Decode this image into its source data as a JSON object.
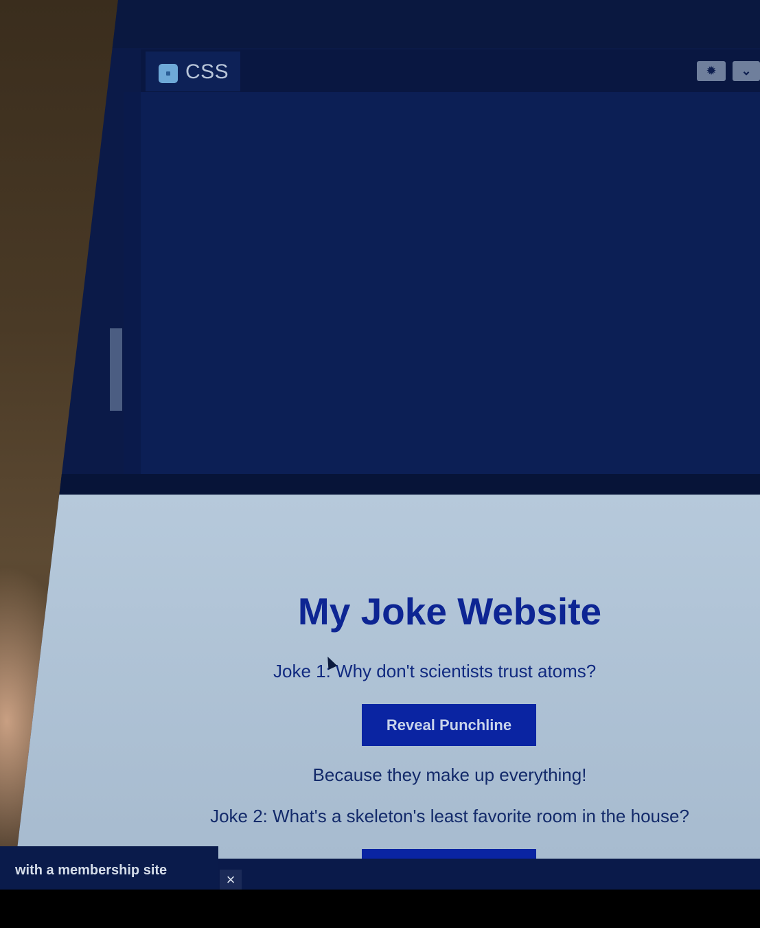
{
  "editor": {
    "tab_label": "CSS",
    "tab_icon": "css-file-icon",
    "settings_icon": "gear-icon",
    "expand_icon": "chevron-down-icon"
  },
  "preview": {
    "title": "My Joke Website",
    "joke1": "Joke 1: Why don't scientists trust atoms?",
    "reveal_label": "Reveal Punchline",
    "punchline1": "Because they make up everything!",
    "joke2": "Joke 2: What's a skeleton's least favorite room in the house?"
  },
  "overlay": {
    "membership_text": "with a membership site",
    "close_label": "×"
  },
  "colors": {
    "editor_bg": "#0c1f55",
    "preview_bg": "#b6c9db",
    "title_color": "#0d2593",
    "button_bg": "#0a24a2"
  }
}
